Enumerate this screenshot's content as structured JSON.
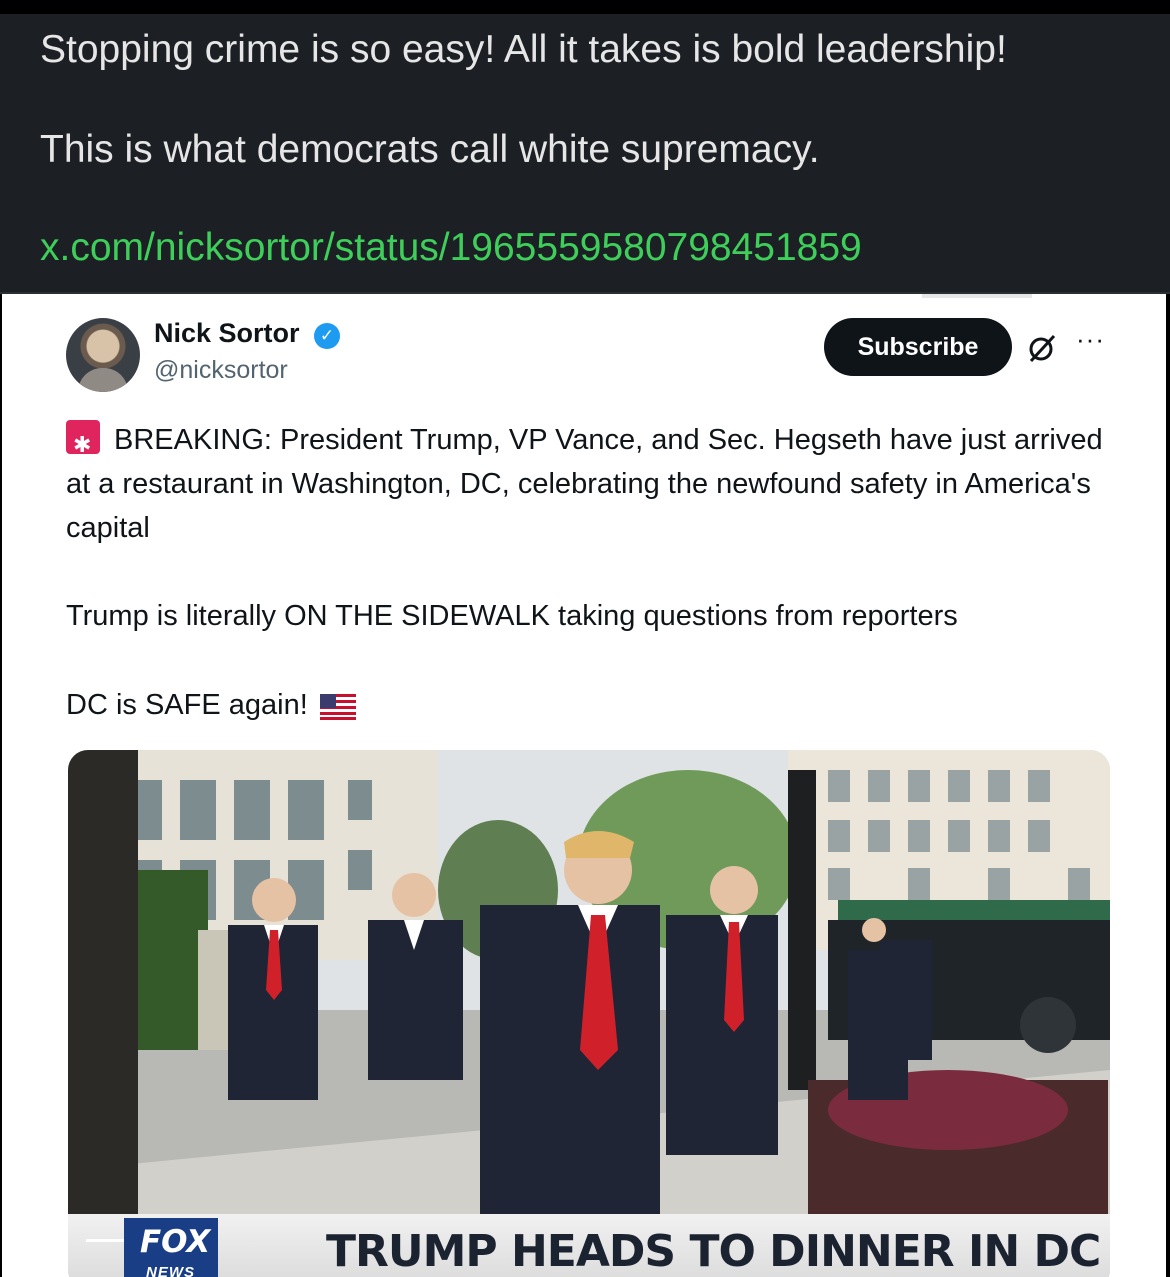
{
  "post": {
    "line1": "Stopping crime is so easy! All it takes is bold leadership!",
    "line2": "This is what democrats call white supremacy.",
    "link": "x.com/nicksortor/status/1965559580798451859"
  },
  "tweet": {
    "author_name": "Nick Sortor",
    "verified_mark": "✓",
    "handle": "@nicksortor",
    "subscribe_label": "Subscribe",
    "more_label": "···",
    "paragraph1": "BREAKING: President Trump, VP Vance, and Sec. Hegseth have just arrived at a restaurant in Washington, DC, celebrating the newfound safety in America's capital",
    "paragraph2": "Trump is literally ON THE SIDEWALK taking questions from reporters",
    "paragraph3": "DC is SAFE again!",
    "icons": [
      "siren-icon",
      "us-flag-icon",
      "grok-icon",
      "more-icon",
      "verified-badge-icon"
    ]
  },
  "media": {
    "logo_top": "FOX",
    "logo_bottom": "NEWS",
    "chyron": "TRUMP HEADS TO DINNER IN DC"
  },
  "colors": {
    "post_background": "#1c2025",
    "link": "#3ecf5a",
    "verified": "#1d9bf0",
    "subscribe": "#0f1419",
    "fox_blue": "#1a3e86"
  }
}
